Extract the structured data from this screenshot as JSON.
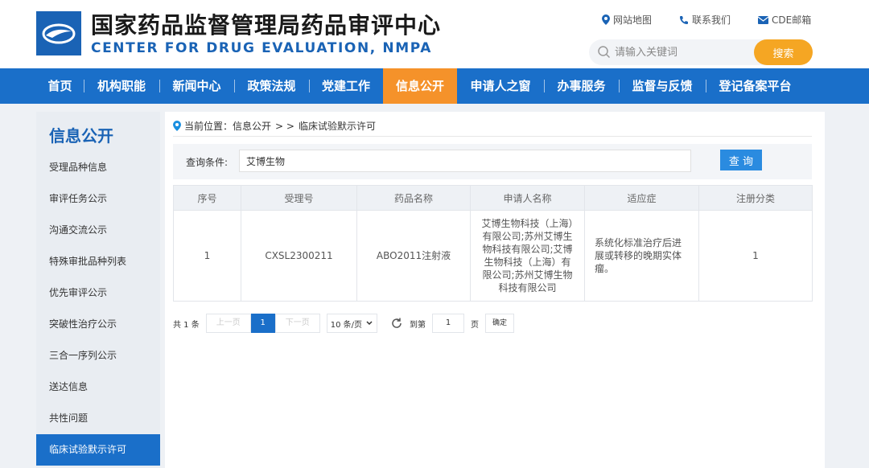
{
  "header": {
    "title_cn": "国家药品监督管理局药品审评中心",
    "title_en": "CENTER FOR DRUG EVALUATION, NMPA",
    "links": [
      "网站地图",
      "联系我们",
      "CDE邮箱"
    ],
    "search_placeholder": "请输入关键词",
    "search_button": "搜索",
    "accent_color": "#f5a623",
    "brand_color": "#1a63b5"
  },
  "nav": {
    "items": [
      "首页",
      "机构职能",
      "新闻中心",
      "政策法规",
      "党建工作",
      "信息公开",
      "申请人之窗",
      "办事服务",
      "监督与反馈",
      "登记备案平台"
    ],
    "active": "信息公开"
  },
  "sidebar": {
    "title": "信息公开",
    "items": [
      "受理品种信息",
      "审评任务公示",
      "沟通交流公示",
      "特殊审批品种列表",
      "优先审评公示",
      "突破性治疗公示",
      "三合一序列公示",
      "送达信息",
      "共性问题",
      "临床试验默示许可"
    ],
    "active": "临床试验默示许可"
  },
  "breadcrumb": {
    "prefix": "当前位置：信息公开",
    "sep": "> >",
    "current": "临床试验默示许可"
  },
  "query": {
    "label": "查询条件:",
    "value": "艾博生物",
    "button": "查 询"
  },
  "table": {
    "headers": [
      "序号",
      "受理号",
      "药品名称",
      "申请人名称",
      "适应症",
      "注册分类"
    ],
    "rows": [
      {
        "index": "1",
        "accept_no": "CXSL2300211",
        "drug": "ABO2011注射液",
        "applicant": "艾博生物科技（上海）有限公司;苏州艾博生物科技有限公司;艾博生物科技（上海）有限公司;苏州艾博生物科技有限公司",
        "indication": "系统化标准治疗后进展或转移的晚期实体瘤。",
        "category": "1"
      }
    ]
  },
  "pager": {
    "total": "共 1 条",
    "prev": "上一页",
    "page": "1",
    "next": "下一页",
    "page_size": "10 条/页",
    "goto_label": "到第",
    "goto_value": "1",
    "page_unit": "页",
    "confirm": "确定"
  }
}
